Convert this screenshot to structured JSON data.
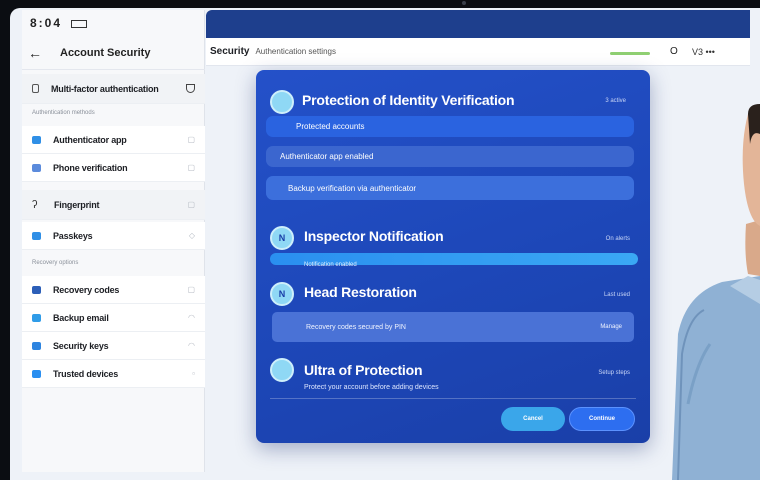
{
  "statusbar": {
    "time": "8:04"
  },
  "sidebar": {
    "title": "Account Security",
    "header_item": "Multi-factor authentication",
    "section1_label": "Authentication methods",
    "items_group1": [
      {
        "label": "Authenticator app"
      },
      {
        "label": "Phone verification"
      }
    ],
    "group2_item": "Fingerprint",
    "group2_item2": "Passkeys",
    "section2_label": "Recovery options",
    "items_group3": [
      {
        "label": "Recovery codes"
      },
      {
        "label": "Backup email"
      },
      {
        "label": "Security keys"
      },
      {
        "label": "Trusted devices"
      }
    ]
  },
  "subbar": {
    "crumb": "Security",
    "crumb_sub": "Authentication settings",
    "status": "O",
    "version": "V3 •••"
  },
  "card": {
    "section1": {
      "icon": "",
      "title": "Protection of Identity Verification",
      "meta": "3 active",
      "field1": "Protected accounts",
      "field2": "Authenticator app enabled",
      "field3": "Backup verification via authenticator"
    },
    "section2": {
      "icon": "N",
      "title": "Inspector Notification",
      "meta": "On alerts",
      "bar_label": "Notification enabled"
    },
    "section3": {
      "icon": "N",
      "title": "Head Restoration",
      "meta": "Last used",
      "row_left": "Recovery codes secured by PIN",
      "row_right": "Manage"
    },
    "section4": {
      "title": "Ultra of Protection",
      "meta": "Setup steps",
      "note": "Protect your account before adding devices",
      "btn_secondary": "Cancel",
      "btn_primary": "Continue"
    }
  },
  "colors": {
    "card_blue": "#1d47b8",
    "topbar": "#1e3f8d",
    "accent": "#2f8fe6"
  }
}
